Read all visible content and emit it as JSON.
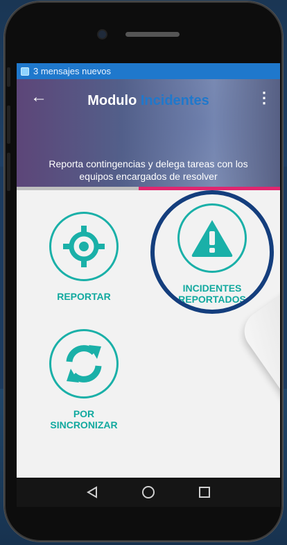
{
  "status_bar": {
    "notification_text": "3 mensajes nuevos"
  },
  "header": {
    "title_main": "Modulo",
    "title_accent": "Incidentes",
    "subtitle": "Reporta contingencias y delega tareas con los equipos encargados de resolver"
  },
  "tiles": {
    "reportar": {
      "label": "REPORTAR",
      "icon": "crosshair-icon"
    },
    "incidentes": {
      "label_line1": "INCIDENTES",
      "label_line2": "REPORTADOS",
      "icon": "warning-icon"
    },
    "sincronizar": {
      "label_line1": "POR",
      "label_line2": "SINCRONIZAR",
      "icon": "sync-icon"
    }
  },
  "colors": {
    "accent": "#1ab0a8",
    "status_bar": "#1f78cc",
    "title_accent": "#1f78cc",
    "tab_indicator": "#e0266f",
    "highlight_ring": "#143e7d"
  }
}
